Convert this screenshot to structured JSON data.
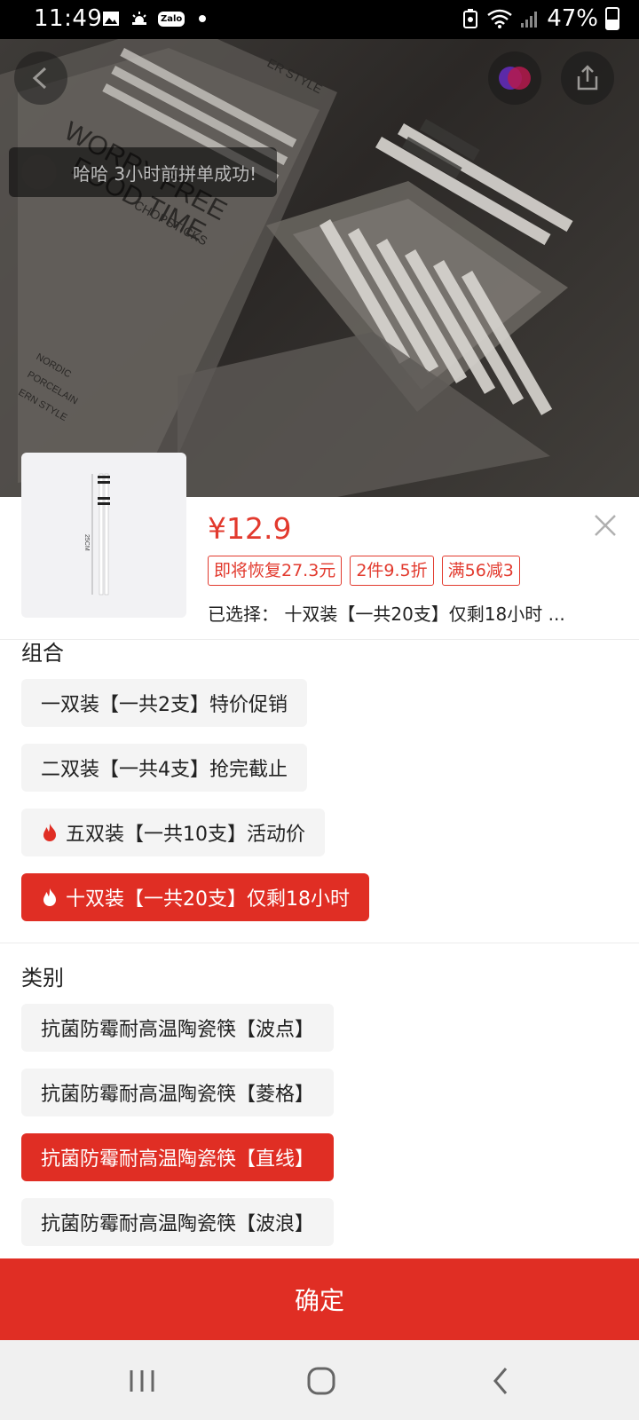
{
  "status_bar": {
    "time": "11:49",
    "zalo_label": "Zalo",
    "battery_percent": "47%"
  },
  "hero": {
    "toast_text": "哈哈 3小时前拼单成功!",
    "photo_text_line1": "WORRY FREE",
    "photo_text_line2": "FOOD TIME",
    "photo_text_line3": "CHOPSTICKS",
    "photo_text_line4": "ER STYLE",
    "photo_text_side1": "NORDIC",
    "photo_text_side2": "PORCELAIN",
    "photo_text_side3": "ERN STYLE"
  },
  "product": {
    "thumb_label": "25CM",
    "price": "¥12.9",
    "tags": [
      "即将恢复27.3元",
      "2件9.5折",
      "满56减3"
    ],
    "selected": "已选择： 十双装【一共20支】仅剩18小时 ..."
  },
  "combo": {
    "title": "组合",
    "options": [
      {
        "label": "一双装【一共2支】特价促销",
        "hot": false,
        "selected": false
      },
      {
        "label": "二双装【一共4支】抢完截止",
        "hot": false,
        "selected": false
      },
      {
        "label": "五双装【一共10支】活动价",
        "hot": true,
        "selected": false
      },
      {
        "label": "十双装【一共20支】仅剩18小时",
        "hot": true,
        "selected": true
      }
    ]
  },
  "category": {
    "title": "类别",
    "options": [
      {
        "label": "抗菌防霉耐高温陶瓷筷【波点】",
        "selected": false
      },
      {
        "label": "抗菌防霉耐高温陶瓷筷【菱格】",
        "selected": false
      },
      {
        "label": "抗菌防霉耐高温陶瓷筷【直线】",
        "selected": true
      },
      {
        "label": "抗菌防霉耐高温陶瓷筷【波浪】",
        "selected": false
      }
    ]
  },
  "confirm_label": "确定",
  "colors": {
    "accent": "#e02e24",
    "price": "#e23a2e"
  }
}
